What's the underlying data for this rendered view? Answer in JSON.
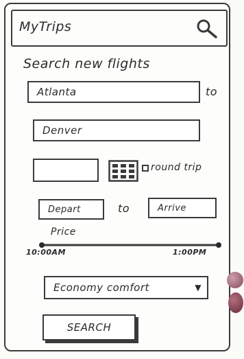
{
  "header": {
    "title": "MyTrips",
    "search_icon": "search-icon"
  },
  "search": {
    "title": "Search new flights",
    "from_value": "Atlanta",
    "to_word": "to",
    "to_value": "Denver",
    "date_value": "",
    "calendar_icon": "calendar-icon",
    "round_trip_label": "round trip",
    "round_trip_checked": false,
    "depart_label": "Depart",
    "range_word": "to",
    "arrive_label": "Arrive"
  },
  "price": {
    "label": "Price",
    "min_label": "10:00AM",
    "max_label": "1:00PM"
  },
  "class_select": {
    "selected": "Economy comfort"
  },
  "actions": {
    "search_label": "SEARCH"
  },
  "colors": {
    "ink": "#3a3a3a",
    "dot": "#8a4a5a"
  }
}
